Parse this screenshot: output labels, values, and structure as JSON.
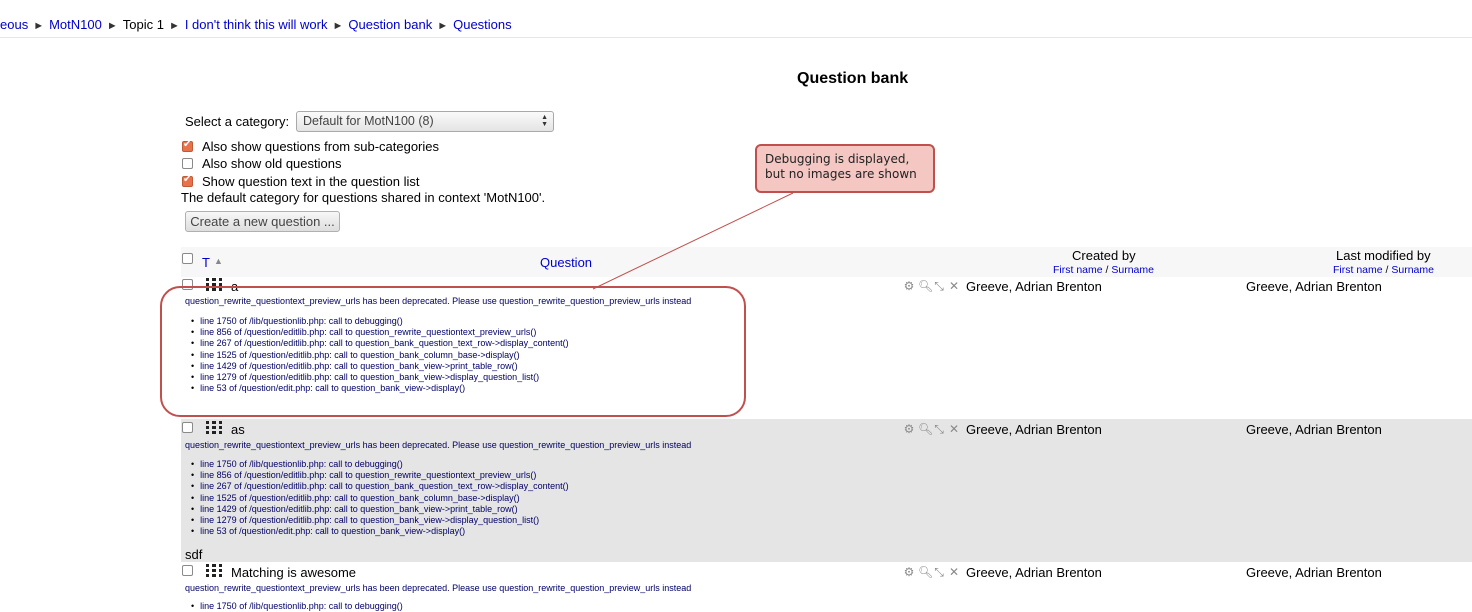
{
  "breadcrumb": {
    "items": [
      "eous",
      "MotN100",
      "Topic 1",
      "I don't think this will work",
      "Question bank",
      "Questions"
    ],
    "separator": "►"
  },
  "page_title": "Question bank",
  "category": {
    "label": "Select a category:",
    "selected": "Default for MotN100 (8)"
  },
  "options": [
    {
      "label": "Also show questions from sub-categories",
      "checked": true
    },
    {
      "label": "Also show old questions",
      "checked": false
    },
    {
      "label": "Show question text in the question list",
      "checked": true
    }
  ],
  "context_note": "The default category for questions shared in context 'MotN100'.",
  "create_button": "Create a new question ...",
  "table": {
    "headers": {
      "type": "T",
      "question": "Question",
      "created_by": "Created by",
      "last_modified_by": "Last modified by",
      "first_name": "First name",
      "slash": "/",
      "surname": "Surname"
    },
    "deprecation": "question_rewrite_questiontext_preview_urls has been deprecated. Please use question_rewrite_question_preview_urls instead",
    "trace": [
      "line 1750 of /lib/questionlib.php: call to debugging()",
      "line 856 of /question/editlib.php: call to question_rewrite_questiontext_preview_urls()",
      "line 267 of /question/editlib.php: call to question_bank_question_text_row->display_content()",
      "line 1525 of /question/editlib.php: call to question_bank_column_base->display()",
      "line 1429 of /question/editlib.php: call to question_bank_view->print_table_row()",
      "line 1279 of /question/editlib.php: call to question_bank_view->display_question_list()",
      "line 53 of /question/edit.php: call to question_bank_view->display()"
    ],
    "rows": [
      {
        "name": "a",
        "created_by": "Greeve, Adrian Brenton",
        "modified_by": "Greeve, Adrian Brenton"
      },
      {
        "name": "as",
        "created_by": "Greeve, Adrian Brenton",
        "modified_by": "Greeve, Adrian Brenton",
        "extra_text": "sdf"
      },
      {
        "name": "Matching is awesome",
        "created_by": "Greeve, Adrian Brenton",
        "modified_by": "Greeve, Adrian Brenton"
      }
    ],
    "row3_trace_partial": "line 1750 of /lib/questionlib.php: call to debugging()"
  },
  "annotation": {
    "line1": "Debugging is displayed,",
    "line2": "but no images are shown"
  },
  "colors": {
    "link": "#0000cc",
    "callout_fill": "#f4c7c3",
    "callout_border": "#c0504d",
    "row_alt": "#e5e5e5"
  }
}
